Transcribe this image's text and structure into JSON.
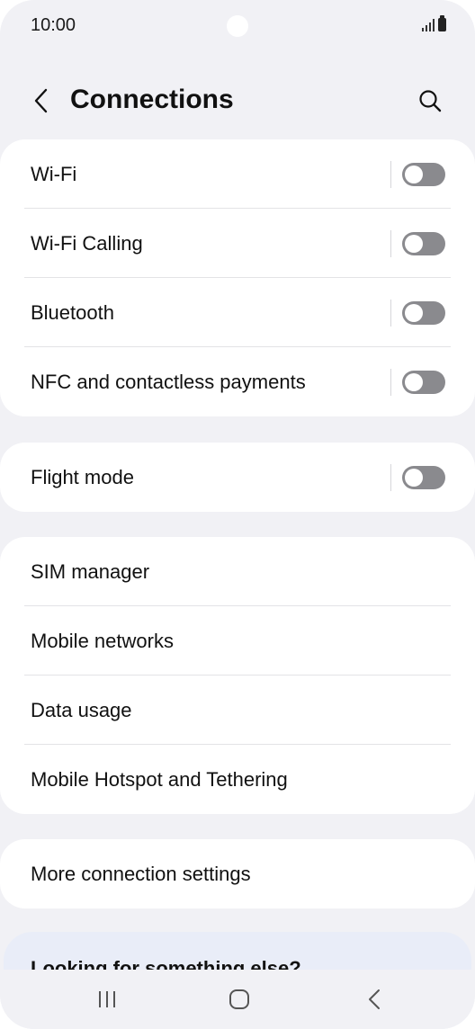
{
  "status_bar": {
    "time": "10:00"
  },
  "header": {
    "title": "Connections"
  },
  "groups": [
    {
      "items": [
        {
          "label": "Wi-Fi",
          "has_toggle": true,
          "toggle_on": false
        },
        {
          "label": "Wi-Fi Calling",
          "has_toggle": true,
          "toggle_on": false
        },
        {
          "label": "Bluetooth",
          "has_toggle": true,
          "toggle_on": false
        },
        {
          "label": "NFC and contactless payments",
          "has_toggle": true,
          "toggle_on": false
        }
      ]
    },
    {
      "items": [
        {
          "label": "Flight mode",
          "has_toggle": true,
          "toggle_on": false
        }
      ]
    },
    {
      "items": [
        {
          "label": "SIM manager"
        },
        {
          "label": "Mobile networks"
        },
        {
          "label": "Data usage"
        },
        {
          "label": "Mobile Hotspot and Tethering"
        }
      ]
    },
    {
      "items": [
        {
          "label": "More connection settings"
        }
      ]
    }
  ],
  "looking": {
    "text": "Looking for something else?"
  },
  "colors": {
    "background": "#f1f1f5",
    "card": "#ffffff",
    "toggle_off": "#8a8a8e",
    "looking_card": "#e9edf8"
  }
}
